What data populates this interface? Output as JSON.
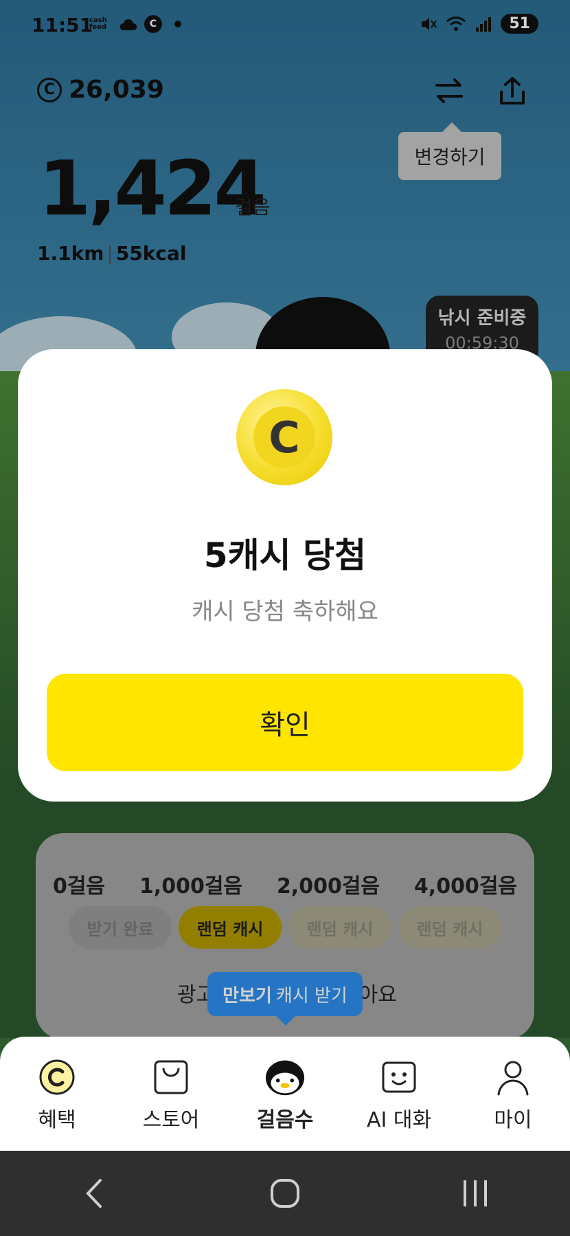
{
  "status_bar": {
    "time": "11:51",
    "app_badge": "cash feed",
    "battery": "51"
  },
  "header": {
    "cash_symbol": "C",
    "cash_amount": "26,039",
    "switch_tooltip": "변경하기"
  },
  "stats": {
    "steps": "1,424",
    "steps_unit": "걸음",
    "distance": "1.1km",
    "separator": "|",
    "calories": "55kcal"
  },
  "fishing_badge": {
    "title": "낚시 준비중",
    "timer": "00:59:30"
  },
  "modal": {
    "coin_symbol": "C",
    "title": "5캐시 당첨",
    "subtitle": "캐시 당첨 축하해요",
    "confirm_label": "확인"
  },
  "milestone_card": {
    "milestones": [
      "0걸음",
      "1,000걸음",
      "2,000걸음",
      "4,000걸음"
    ],
    "chips": [
      "받기 완료",
      "랜덤 캐시",
      "랜덤 캐시",
      "랜덤 캐시"
    ],
    "ad_text_left": "광고",
    "ad_text_right": "아요",
    "bubble_bold": "만보기",
    "bubble_rest": "캐시 받기"
  },
  "bottom_nav": {
    "items": [
      {
        "label": "혜택",
        "icon": "coin-icon"
      },
      {
        "label": "스토어",
        "icon": "shopping-bag-icon"
      },
      {
        "label": "걸음수",
        "icon": "penguin-icon"
      },
      {
        "label": "AI 대화",
        "icon": "chat-face-icon"
      },
      {
        "label": "마이",
        "icon": "person-icon"
      }
    ],
    "active_index": 2
  },
  "colors": {
    "accent_yellow": "#ffe500",
    "bubble_blue": "#2f8ff0"
  }
}
